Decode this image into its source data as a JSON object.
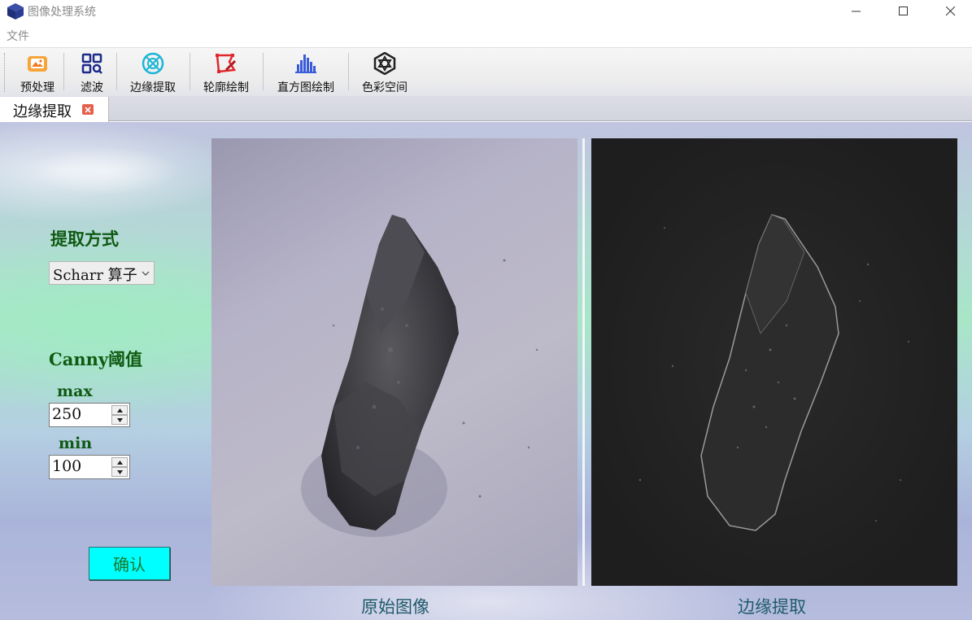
{
  "window": {
    "title": "图像处理系统"
  },
  "menu": {
    "file": "文件"
  },
  "toolbar": {
    "buttons": [
      {
        "label": "预处理",
        "icon": "image-icon"
      },
      {
        "label": "滤波",
        "icon": "grid-search-icon"
      },
      {
        "label": "边缘提取",
        "icon": "edge-circle-icon"
      },
      {
        "label": "轮廓绘制",
        "icon": "polygon-pen-icon"
      },
      {
        "label": "直方图绘制",
        "icon": "histogram-icon"
      },
      {
        "label": "色彩空间",
        "icon": "color-space-icon"
      }
    ]
  },
  "tabs": [
    {
      "label": "边缘提取",
      "active": true
    }
  ],
  "controls": {
    "method_label": "提取方式",
    "method_value": "Scharr 算子",
    "canny_label": "Canny阈值",
    "max_label": "max",
    "max_value": "250",
    "min_label": "min",
    "min_value": "100",
    "confirm_label": "确认"
  },
  "images": {
    "original_caption": "原始图像",
    "edge_caption": "边缘提取"
  },
  "colors": {
    "label_green": "#0f5a12",
    "confirm_bg": "#00ffff",
    "tab_close": "#e4604a"
  }
}
